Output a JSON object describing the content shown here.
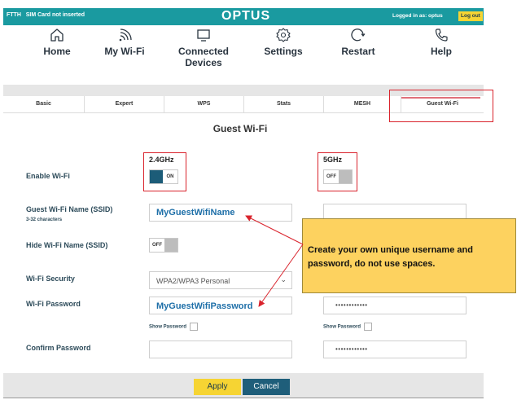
{
  "header": {
    "conn_type": "FTTH",
    "sim_status": "SIM Card not inserted",
    "brand": "OPTUS",
    "logged_in": "Logged in as: optus",
    "logout": "Log out"
  },
  "nav": [
    {
      "label": "Home",
      "icon": "home-icon"
    },
    {
      "label": "My Wi-Fi",
      "icon": "wifi-icon"
    },
    {
      "label": "Connected Devices",
      "icon": "monitor-icon"
    },
    {
      "label": "Settings",
      "icon": "gear-icon"
    },
    {
      "label": "Restart",
      "icon": "restart-icon"
    },
    {
      "label": "Help",
      "icon": "phone-icon"
    }
  ],
  "tabs": [
    "Basic",
    "Expert",
    "WPS",
    "Stats",
    "MESH",
    "Guest Wi-Fi"
  ],
  "active_tab": "Guest Wi-Fi",
  "page_title": "Guest Wi-Fi",
  "bands": {
    "b24": "2.4GHz",
    "b5": "5GHz"
  },
  "form": {
    "enable_label": "Enable Wi-Fi",
    "enable_24": "ON",
    "enable_5": "OFF",
    "ssid_label": "Guest Wi-Fi Name (SSID)",
    "ssid_hint": "3-32 characters",
    "ssid_24": "MyGuestWifiName",
    "hide_label": "Hide Wi-Fi Name (SSID)",
    "hide_24": "OFF",
    "security_label": "Wi-Fi Security",
    "security_24": "WPA2/WPA3 Personal",
    "password_label": "Wi-Fi Password",
    "password_24": "MyGuestWifiPassword",
    "password_5": "••••••••••••",
    "show_password": "Show Password",
    "confirm_label": "Confirm Password",
    "confirm_5": "••••••••••••"
  },
  "callout": "Create your own unique username and password, do not use spaces.",
  "buttons": {
    "apply": "Apply",
    "cancel": "Cancel"
  },
  "colors": {
    "teal": "#1a9aa0",
    "accent_yellow": "#f6d433",
    "callout_bg": "#fdd25f",
    "annotation_red": "#d9232c",
    "toggle_on": "#1c5c78"
  }
}
